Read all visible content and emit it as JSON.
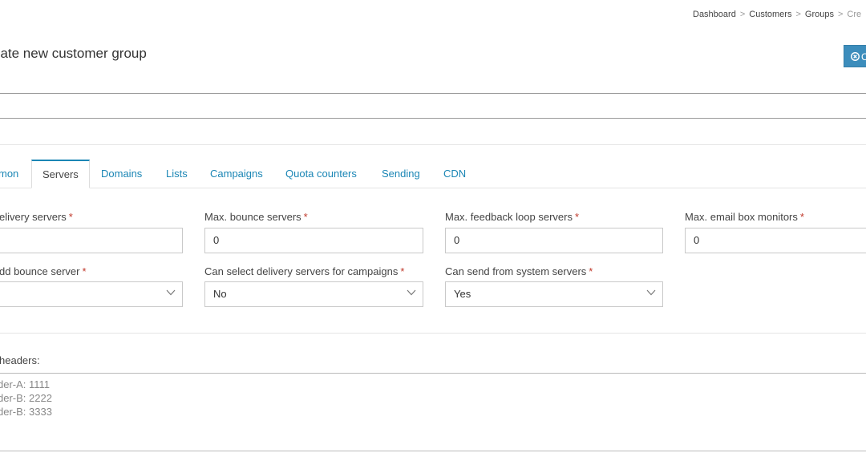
{
  "breadcrumb": {
    "items": [
      "Dashboard",
      "Customers",
      "Groups"
    ],
    "current": "Cre",
    "separator": ">"
  },
  "page": {
    "title": "eate new customer group",
    "close_icon": "circle-x-icon",
    "close_label": "C",
    "name_label_stub": "‘",
    "name_value_stub": "‘"
  },
  "tabs": [
    {
      "label": "mon",
      "active": false
    },
    {
      "label": "Servers",
      "active": true
    },
    {
      "label": "Domains",
      "active": false
    },
    {
      "label": "Lists",
      "active": false
    },
    {
      "label": "Campaigns",
      "active": false
    },
    {
      "label": "Quota counters",
      "active": false
    },
    {
      "label": "Sending",
      "active": false
    },
    {
      "label": "CDN",
      "active": false
    }
  ],
  "fields": {
    "max_delivery": {
      "label": "elivery servers",
      "value": ""
    },
    "max_bounce": {
      "label": "Max. bounce servers",
      "value": "0"
    },
    "max_fbl": {
      "label": "Max. feedback loop servers",
      "value": "0"
    },
    "max_email_box": {
      "label": "Max. email box monitors",
      "value": "0"
    },
    "must_add_bounce": {
      "label": "dd bounce server",
      "value": ""
    },
    "can_select_delivery": {
      "label": "Can select delivery servers for campaigns",
      "value": "No"
    },
    "can_send_system": {
      "label": "Can send from system servers",
      "value": "Yes"
    }
  },
  "required_marker": "*",
  "custom_headers": {
    "label": "headers:",
    "lines": [
      "der-A: 1111",
      "der-B: 2222",
      "der-B: 3333"
    ]
  },
  "colors": {
    "accent": "#1b86b5",
    "button": "#3c8dbc",
    "required": "#c0392b"
  }
}
